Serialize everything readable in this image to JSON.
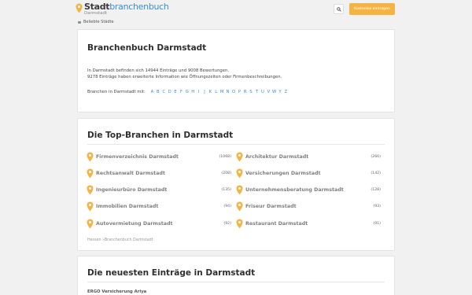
{
  "header": {
    "logo_part1": "Stadt",
    "logo_part2": "branchenbuch",
    "logo_sub": "Darmstadt",
    "search_icon": "search-icon",
    "cta_label": "Kostenlos eintragen"
  },
  "nav": {
    "popular_label": "Beliebte Städte"
  },
  "intro": {
    "title": "Branchenbuch Darmstadt",
    "line1": "In Darmstadt befinden sich 14944 Einträge und 9008 Bewertungen.",
    "line2": "9278 Einträge haben erweiterte Information wie Öffnungszeiten oder Firmenbeschreibungen.",
    "letters_label": "Branchen in Darmstadt mit:",
    "letters": [
      "A",
      "B",
      "C",
      "D",
      "E",
      "F",
      "G",
      "H",
      "I",
      "J",
      "K",
      "L",
      "M",
      "N",
      "O",
      "P",
      "R",
      "S",
      "T",
      "U",
      "V",
      "W",
      "Y",
      "Z"
    ]
  },
  "top": {
    "title": "Die Top-Branchen in Darmstadt",
    "items": [
      {
        "name": "Firmenverzeichnis Darmstadt",
        "count": "(1068)"
      },
      {
        "name": "Architektur Darmstadt",
        "count": "(266)"
      },
      {
        "name": "Rechtsanwalt Darmstadt",
        "count": "(208)"
      },
      {
        "name": "Versicherungen Darmstadt",
        "count": "(142)"
      },
      {
        "name": "Ingenieurbüro Darmstadt",
        "count": "(135)"
      },
      {
        "name": "Unternehmensberatung Darmstadt",
        "count": "(128)"
      },
      {
        "name": "Immobilien Darmstadt",
        "count": "(94)"
      },
      {
        "name": "Friseur Darmstadt",
        "count": "(93)"
      },
      {
        "name": "Autovermietung Darmstadt",
        "count": "(92)"
      },
      {
        "name": "Restaurant Darmstadt",
        "count": "(91)"
      }
    ],
    "crumb1": "Hessen",
    "crumb_sep": "»",
    "crumb2": "Branchenbuch Darmstadt"
  },
  "newest": {
    "title": "Die neuesten Einträge in Darmstadt",
    "first_entry": "ERGO Versicherung Ariya"
  },
  "colors": {
    "accent": "#3b8ed8",
    "pin": "#f4b342",
    "button": "#f4b342"
  }
}
